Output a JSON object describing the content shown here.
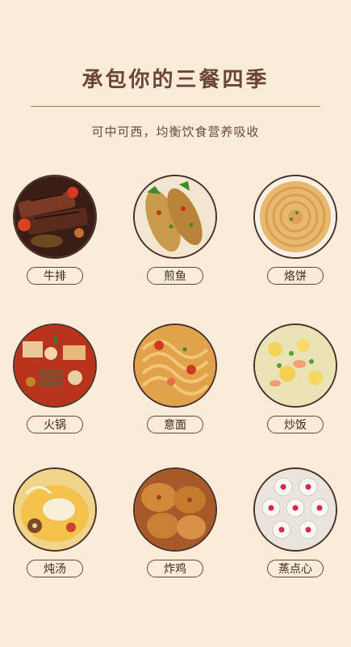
{
  "header": {
    "title": "承包你的三餐四季",
    "subtitle": "可中可西，均衡饮食营养吸收"
  },
  "dishes": [
    {
      "label": "牛排",
      "icon": "steak-photo"
    },
    {
      "label": "煎鱼",
      "icon": "fried-fish-photo"
    },
    {
      "label": "烙饼",
      "icon": "pancake-photo"
    },
    {
      "label": "火锅",
      "icon": "hotpot-photo"
    },
    {
      "label": "意面",
      "icon": "spaghetti-photo"
    },
    {
      "label": "炒饭",
      "icon": "fried-rice-photo"
    },
    {
      "label": "炖汤",
      "icon": "stew-soup-photo"
    },
    {
      "label": "炸鸡",
      "icon": "fried-chicken-photo"
    },
    {
      "label": "蒸点心",
      "icon": "steamed-dimsum-photo"
    }
  ]
}
